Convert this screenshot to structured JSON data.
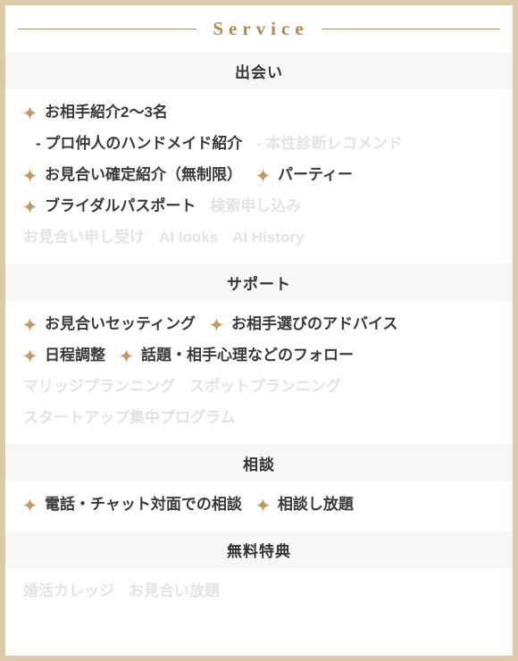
{
  "header": {
    "title": "Service",
    "left_rule": "rule",
    "right_rule": "rule"
  },
  "colors": {
    "border": "#ddcaa9",
    "accent_gold": "#b0894f",
    "bullet_gold": "#c09a5e",
    "band_bg": "#f7f7f7",
    "text": "#3a3a3a",
    "text_disabled": "#e4e4e4"
  },
  "icons": {
    "bullet": "sparkle-icon"
  },
  "sections": [
    {
      "heading": "出会い",
      "rows": [
        {
          "items": [
            {
              "label": "お相手紹介2〜3名",
              "bullet": true,
              "enabled": true,
              "sub": false
            }
          ]
        },
        {
          "items": [
            {
              "label": "- プロ仲人のハンドメイド紹介",
              "bullet": false,
              "enabled": true,
              "sub": true
            },
            {
              "label": "- 本性診断レコメンド",
              "bullet": false,
              "enabled": false,
              "sub": false
            }
          ]
        },
        {
          "items": [
            {
              "label": "お見合い確定紹介（無制限）",
              "bullet": true,
              "enabled": true,
              "sub": false
            },
            {
              "label": "パーティー",
              "bullet": true,
              "enabled": true,
              "sub": false
            }
          ]
        },
        {
          "items": [
            {
              "label": "ブライダルパスポート",
              "bullet": true,
              "enabled": true,
              "sub": false
            },
            {
              "label": "検索申し込み",
              "bullet": false,
              "enabled": false,
              "sub": false
            }
          ]
        },
        {
          "items": [
            {
              "label": "お見合い申し受け",
              "bullet": false,
              "enabled": false,
              "sub": false
            },
            {
              "label": "AI looks",
              "bullet": false,
              "enabled": false,
              "sub": false
            },
            {
              "label": "AI History",
              "bullet": false,
              "enabled": false,
              "sub": false
            }
          ]
        }
      ]
    },
    {
      "heading": "サポート",
      "rows": [
        {
          "items": [
            {
              "label": "お見合いセッティング",
              "bullet": true,
              "enabled": true,
              "sub": false
            },
            {
              "label": "お相手選びのアドバイス",
              "bullet": true,
              "enabled": true,
              "sub": false
            }
          ]
        },
        {
          "items": [
            {
              "label": "日程調整",
              "bullet": true,
              "enabled": true,
              "sub": false
            },
            {
              "label": "話題・相手心理などのフォロー",
              "bullet": true,
              "enabled": true,
              "sub": false
            }
          ]
        },
        {
          "items": [
            {
              "label": "マリッジプランニング",
              "bullet": false,
              "enabled": false,
              "sub": false
            },
            {
              "label": "スポットプランニング",
              "bullet": false,
              "enabled": false,
              "sub": false
            }
          ]
        },
        {
          "items": [
            {
              "label": "スタートアップ集中プログラム",
              "bullet": false,
              "enabled": false,
              "sub": false
            }
          ]
        }
      ]
    },
    {
      "heading": "相談",
      "rows": [
        {
          "items": [
            {
              "label": "電話・チャット対面での相談",
              "bullet": true,
              "enabled": true,
              "sub": false
            },
            {
              "label": "相談し放題",
              "bullet": true,
              "enabled": true,
              "sub": false
            }
          ]
        }
      ]
    },
    {
      "heading": "無料特典",
      "rows": [
        {
          "items": [
            {
              "label": "婚活カレッジ",
              "bullet": false,
              "enabled": false,
              "sub": false
            },
            {
              "label": "お見合い放題",
              "bullet": false,
              "enabled": false,
              "sub": false
            }
          ]
        }
      ]
    }
  ]
}
